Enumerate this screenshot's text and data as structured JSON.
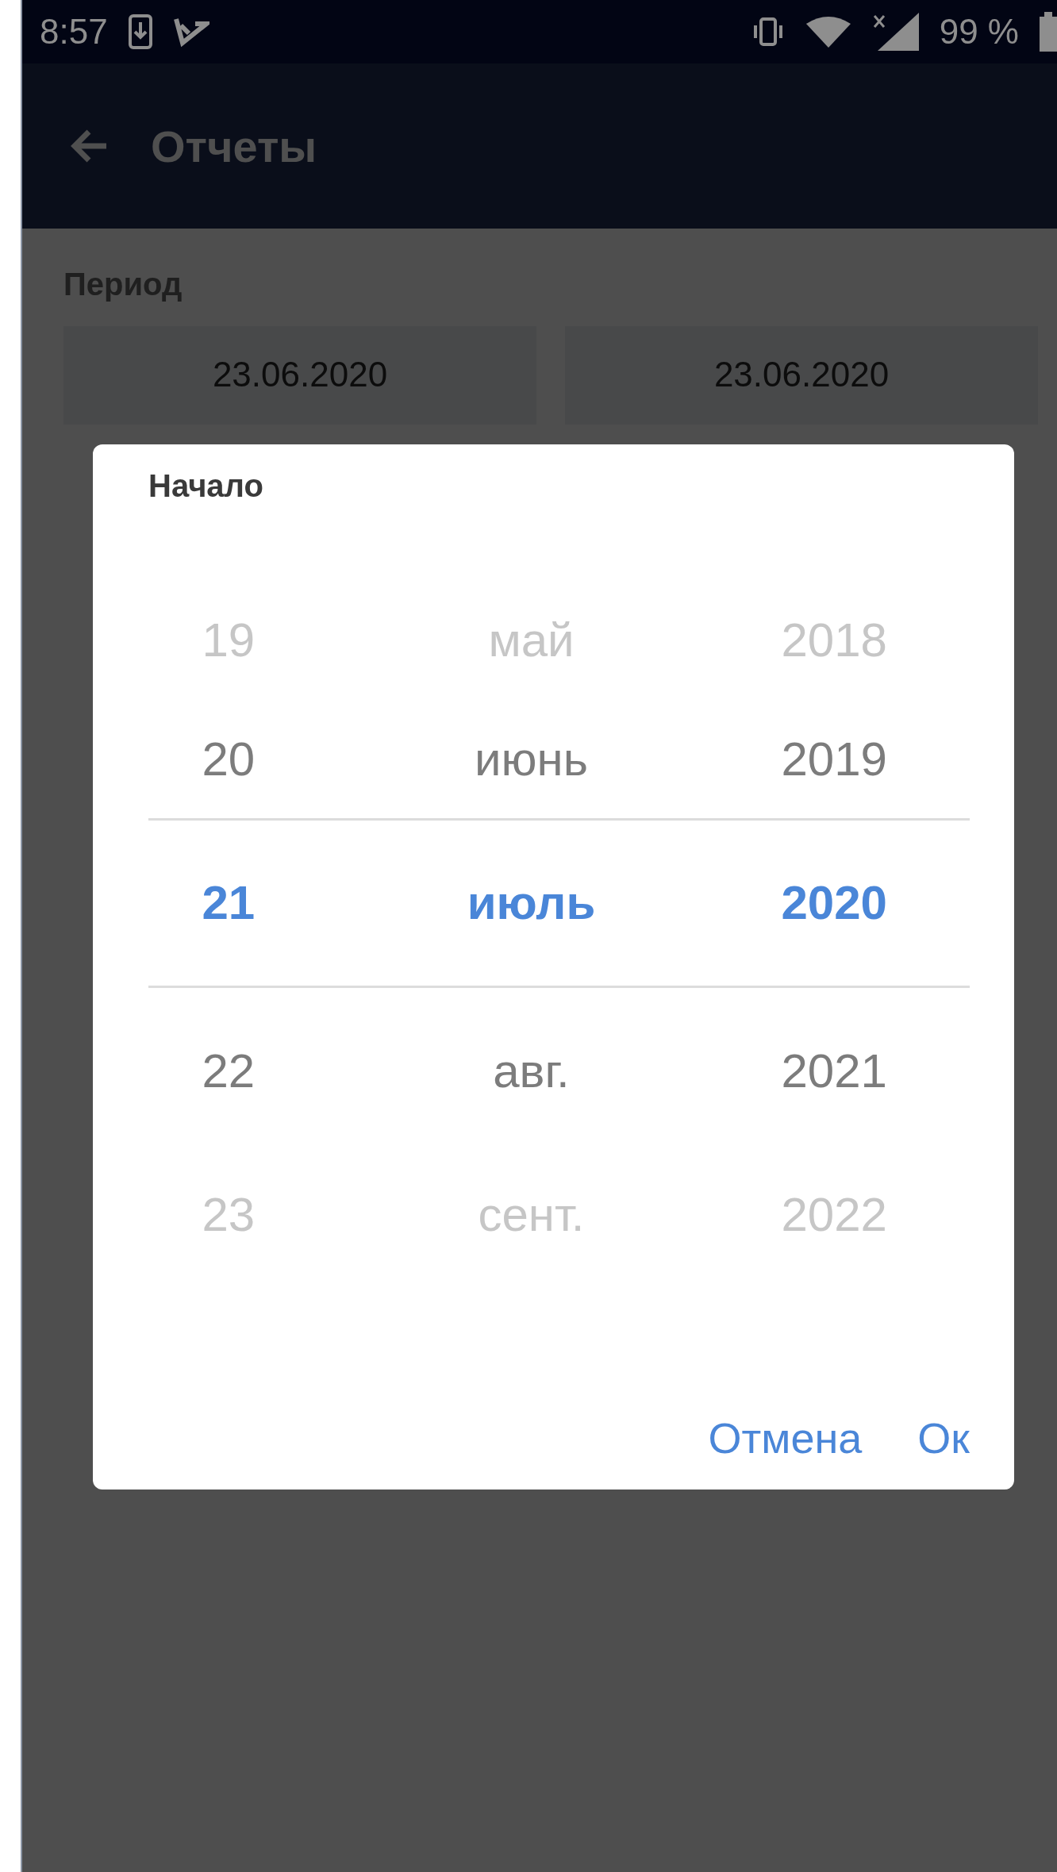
{
  "status_bar": {
    "time": "8:57",
    "battery": "99 %"
  },
  "app_bar": {
    "title": "Отчеты"
  },
  "period": {
    "label": "Период",
    "start": "23.06.2020",
    "end": "23.06.2020"
  },
  "dialog": {
    "title": "Начало",
    "columns": [
      {
        "items": [
          {
            "text": "19",
            "selected": false
          },
          {
            "text": "20",
            "selected": false
          },
          {
            "text": "21",
            "selected": true
          },
          {
            "text": "22",
            "selected": false
          },
          {
            "text": "23",
            "selected": false
          }
        ]
      },
      {
        "items": [
          {
            "text": "май",
            "selected": false
          },
          {
            "text": "июнь",
            "selected": false
          },
          {
            "text": "июль",
            "selected": true
          },
          {
            "text": "авг.",
            "selected": false
          },
          {
            "text": "сент.",
            "selected": false
          }
        ]
      },
      {
        "items": [
          {
            "text": "2018",
            "selected": false
          },
          {
            "text": "2019",
            "selected": false
          },
          {
            "text": "2020",
            "selected": true
          },
          {
            "text": "2021",
            "selected": false
          },
          {
            "text": "2022",
            "selected": false
          }
        ]
      }
    ],
    "buttons": [
      "Отмена",
      "Ок"
    ]
  }
}
